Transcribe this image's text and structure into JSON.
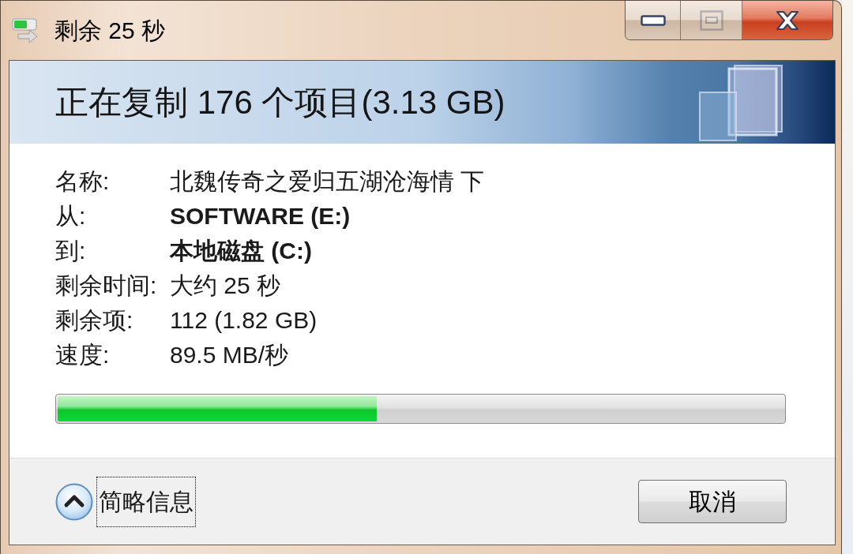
{
  "window": {
    "title": "剩余 25 秒",
    "buttons": [
      {
        "kind": "minimize",
        "disabled": false
      },
      {
        "kind": "maximize",
        "disabled": true
      },
      {
        "kind": "close",
        "disabled": false
      }
    ]
  },
  "header": {
    "title": "正在复制 176 个项目(3.13 GB)"
  },
  "details": [
    {
      "label": "名称:",
      "value": "北魏传奇之爱归五湖沧海情 下",
      "bold": false
    },
    {
      "label": "从:",
      "value": "SOFTWARE (E:)",
      "bold": true
    },
    {
      "label": "到:",
      "value": "本地磁盘 (C:)",
      "bold": true
    },
    {
      "label": "剩余时间:",
      "value": "大约 25 秒",
      "bold": false
    },
    {
      "label": "剩余项:",
      "value": "112 (1.82 GB)",
      "bold": false
    },
    {
      "label": "速度:",
      "value": "89.5 MB/秒",
      "bold": false
    }
  ],
  "progress": {
    "level": 0.44
  },
  "details_toggle": {
    "label": "简略信息",
    "expanded": true,
    "focused": true
  },
  "cancel_button": {
    "label": "取消"
  }
}
